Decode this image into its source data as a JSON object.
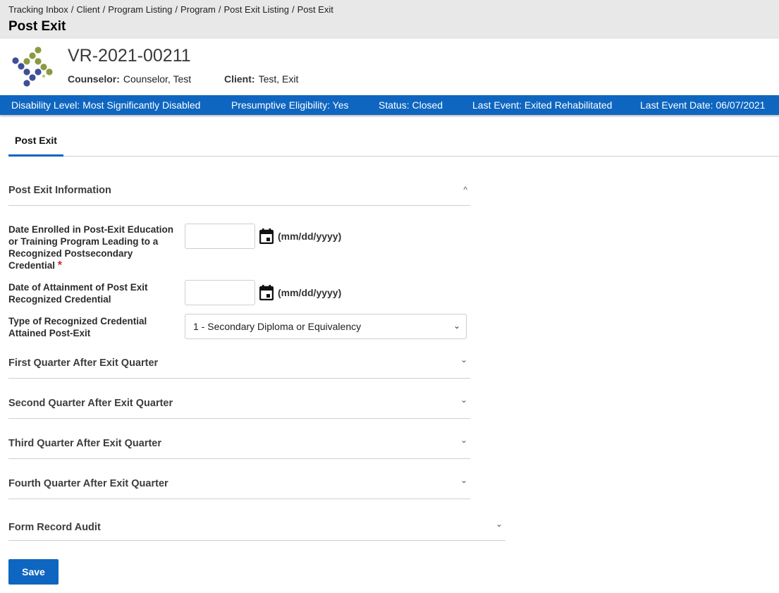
{
  "header": {
    "breadcrumb": [
      "Tracking Inbox",
      "Client",
      "Program Listing",
      "Program",
      "Post Exit Listing",
      "Post Exit"
    ],
    "title": "Post Exit"
  },
  "case": {
    "id": "VR-2021-00211",
    "counselor_label": "Counselor:",
    "counselor_value": "Counselor, Test",
    "client_label": "Client:",
    "client_value": "Test, Exit"
  },
  "status_bar": {
    "disability": "Disability Level: Most Significantly Disabled",
    "presumptive": "Presumptive Eligibility: Yes",
    "status": "Status: Closed",
    "last_event": "Last Event: Exited Rehabilitated",
    "last_event_date": "Last Event Date: 06/07/2021"
  },
  "tabs": [
    {
      "label": "Post Exit",
      "active": true
    }
  ],
  "form": {
    "section_title": "Post Exit Information",
    "fields": {
      "date_enrolled": {
        "label": "Date Enrolled in Post-Exit Education or Training Program Leading to a Recognized Postsecondary Credential",
        "required_mark": "*",
        "value": "",
        "format_hint": "(mm/dd/yyyy)"
      },
      "date_attainment": {
        "label": "Date of Attainment of Post Exit Recognized Credential",
        "value": "",
        "format_hint": "(mm/dd/yyyy)"
      },
      "credential_type": {
        "label": "Type of Recognized Credential Attained Post-Exit",
        "selected": "1 - Secondary Diploma or Equivalency"
      }
    },
    "sections": [
      "First Quarter After Exit Quarter",
      "Second Quarter After Exit Quarter",
      "Third Quarter After Exit Quarter",
      "Fourth Quarter After Exit Quarter"
    ],
    "audit_section": "Form Record Audit",
    "save_label": "Save"
  },
  "icons": {
    "expanded": "^",
    "collapsed": "⌄",
    "caret": "⌄"
  },
  "colors": {
    "brand_blue": "#0e66c0",
    "logo_blue": "#3f4f96",
    "logo_green": "#8a9a43",
    "required": "#e02020"
  }
}
